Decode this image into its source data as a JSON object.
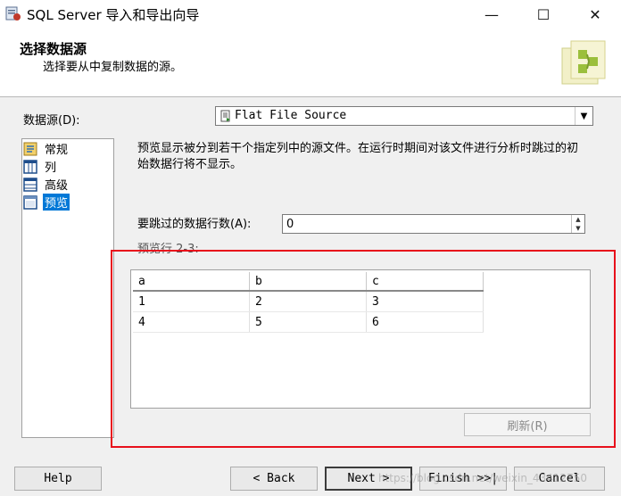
{
  "window": {
    "title": "SQL Server 导入和导出向导",
    "minimize_glyph": "—",
    "maximize_glyph": "☐",
    "close_glyph": "✕"
  },
  "header": {
    "title": "选择数据源",
    "subtitle": "选择要从中复制数据的源。"
  },
  "data_source": {
    "label": "数据源(D):",
    "value": "Flat File Source"
  },
  "nav": {
    "items": [
      {
        "label": "常规",
        "icon": "general-icon"
      },
      {
        "label": "列",
        "icon": "columns-icon"
      },
      {
        "label": "高级",
        "icon": "advanced-icon"
      },
      {
        "label": "预览",
        "icon": "preview-icon",
        "selected": true
      }
    ]
  },
  "preview": {
    "description": "预览显示被分到若干个指定列中的源文件。在运行时期间对该文件进行分析时跳过的初始数据行将不显示。",
    "skip_label": "要跳过的数据行数(A):",
    "skip_value": "0",
    "rows_label": "预览行 2-3:",
    "columns": [
      "a",
      "b",
      "c"
    ],
    "rows": [
      [
        "1",
        "2",
        "3"
      ],
      [
        "4",
        "5",
        "6"
      ]
    ],
    "refresh_label": "刷新(R)"
  },
  "buttons": {
    "help": "Help",
    "back": "< Back",
    "next": "Next >",
    "finish": "Finish >>|",
    "cancel": "Cancel"
  },
  "watermark": "https://blog.csdn.net/weixin_43412750",
  "colors": {
    "highlight_box": "#e8101b",
    "selection": "#0078d7"
  }
}
